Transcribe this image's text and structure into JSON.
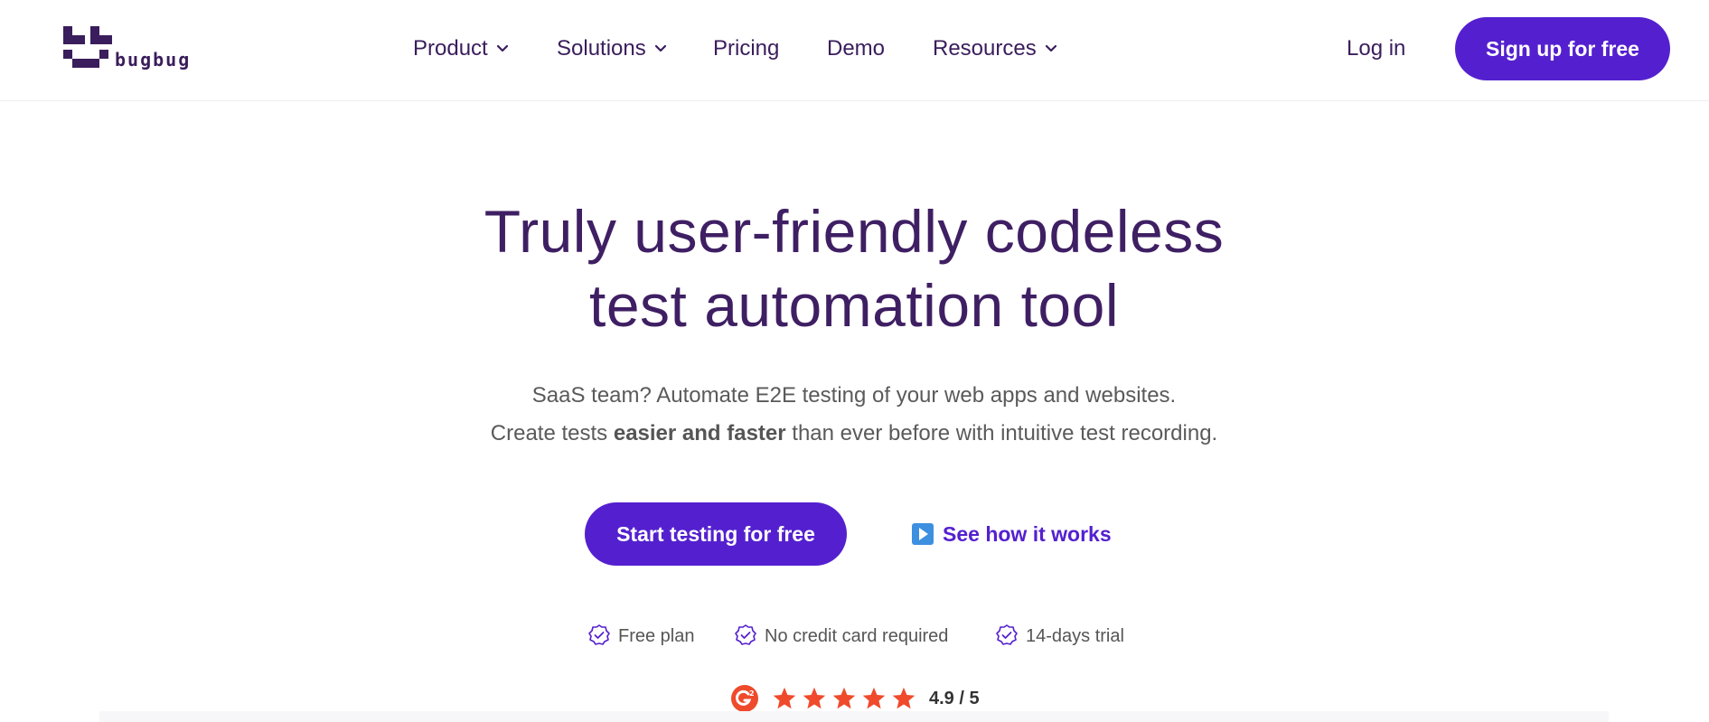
{
  "brand": {
    "name": "bugbug"
  },
  "nav": {
    "items": [
      {
        "label": "Product",
        "has_dropdown": true
      },
      {
        "label": "Solutions",
        "has_dropdown": true
      },
      {
        "label": "Pricing",
        "has_dropdown": false
      },
      {
        "label": "Demo",
        "has_dropdown": false
      },
      {
        "label": "Resources",
        "has_dropdown": true
      }
    ],
    "login_label": "Log in",
    "signup_label": "Sign up for free"
  },
  "hero": {
    "title_line1": "Truly user-friendly codeless",
    "title_line2": "test automation tool",
    "subtitle_line1": "SaaS team? Automate E2E testing of your web apps and websites.",
    "subtitle_line2_prefix": "Create tests ",
    "subtitle_line2_bold": "easier and faster",
    "subtitle_line2_suffix": " than ever before with intuitive test recording.",
    "primary_cta": "Start testing for free",
    "secondary_cta": "See how it works",
    "features": [
      "Free plan",
      "No credit card required",
      "14-days trial"
    ],
    "rating": {
      "stars": 5,
      "value_text": "4.9 / 5"
    }
  },
  "colors": {
    "brand": "#5420cf",
    "heading": "#3f1f63",
    "rating_orange": "#ef4a2b"
  },
  "icons": {
    "nav_dropdown": "chevron-down-icon",
    "secondary_cta": "play-icon",
    "feature": "check-badge-icon",
    "review": "g2-icon",
    "rating": "star-icon"
  }
}
